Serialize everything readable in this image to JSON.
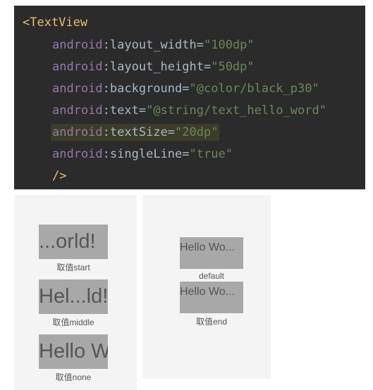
{
  "code": {
    "open_tag": "<TextView",
    "ns": "android",
    "colon": ":",
    "eq": "=",
    "attrs": [
      {
        "name": "layout_width",
        "value": "\"100dp\""
      },
      {
        "name": "layout_height",
        "value": "\"50dp\""
      },
      {
        "name": "background",
        "value": "\"@color/black_p30\""
      },
      {
        "name": "text",
        "value": "\"@string/text_hello_word\""
      },
      {
        "name": "textSize",
        "value": "\"20dp\""
      },
      {
        "name": "singleLine",
        "value": "\"true\""
      }
    ],
    "close_tag": "/>"
  },
  "left_panel": {
    "items": [
      {
        "text": "...orld!",
        "caption": "取值start"
      },
      {
        "text": "Hel...ld!",
        "caption": "取值middle"
      },
      {
        "text": "Hello W",
        "caption": "取值none"
      }
    ]
  },
  "right_panel": {
    "items": [
      {
        "text": "Hello Wo...",
        "caption": "default"
      },
      {
        "text": "Hello Wo...",
        "caption": "取值end"
      }
    ]
  }
}
